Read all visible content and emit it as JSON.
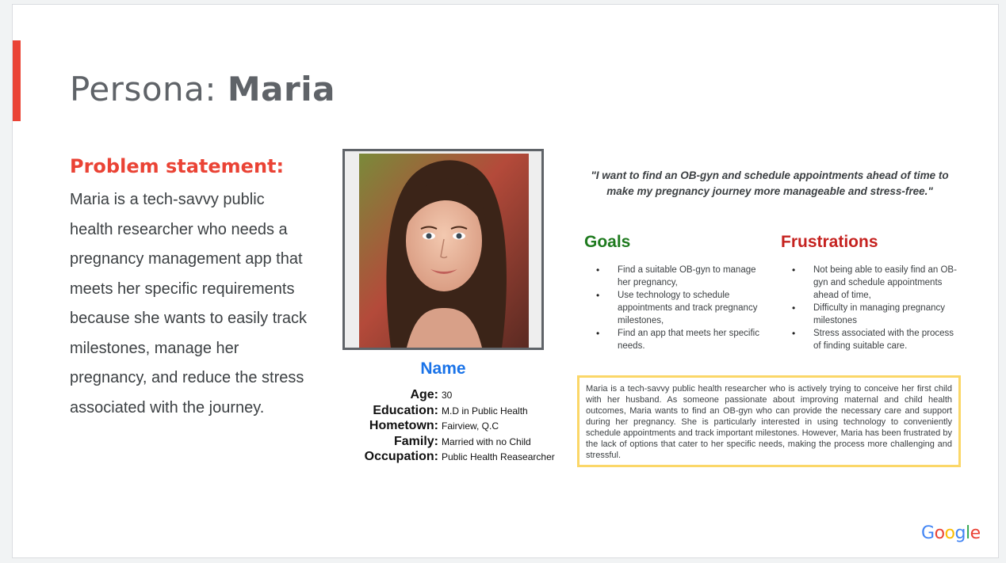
{
  "slide": {
    "title_prefix": "Persona: ",
    "title_name": "Maria"
  },
  "problem": {
    "heading": "Problem statement:",
    "body": "Maria is a tech-savvy public health researcher who needs a pregnancy management app that meets her specific requirements because she wants to easily track milestones, manage her pregnancy, and reduce the stress associated with the journey."
  },
  "persona": {
    "name_label": "Name",
    "details": [
      {
        "key": "Age:",
        "value": "30"
      },
      {
        "key": "Education:",
        "value": "M.D in Public Health"
      },
      {
        "key": "Hometown:",
        "value": "Fairview, Q.C"
      },
      {
        "key": "Family:",
        "value": "Married with no Child"
      },
      {
        "key": "Occupation:",
        "value": "Public Health Reasearcher"
      }
    ]
  },
  "quote": "\"I want to find an OB-gyn and schedule appointments ahead of time to make my pregnancy journey more manageable and stress-free.\"",
  "goals": {
    "heading": "Goals",
    "items": [
      "Find a suitable OB-gyn to manage her pregnancy,",
      "Use technology to schedule appointments and track pregnancy milestones,",
      "Find an app that meets her specific needs."
    ]
  },
  "frustrations": {
    "heading": "Frustrations",
    "items": [
      "Not being able to easily find an OB-gyn and schedule appointments ahead of time,",
      "Difficulty in managing pregnancy milestones",
      "Stress associated with the process of finding suitable care."
    ]
  },
  "bio": "Maria is a tech-savvy public health researcher who is actively trying to conceive her first child with her husband. As someone passionate about improving maternal and child health outcomes, Maria wants to find an OB-gyn who can provide the necessary care and support during her pregnancy. She is particularly interested in using technology to conveniently schedule appointments and track important milestones. However, Maria has been frustrated by the lack of options that cater to her specific needs, making the process more challenging and stressful.",
  "footer": {
    "logo_letters": [
      "G",
      "o",
      "o",
      "g",
      "l",
      "e"
    ],
    "logo_colors": [
      "#4285f4",
      "#ea4335",
      "#fbbc05",
      "#4285f4",
      "#34a853",
      "#ea4335"
    ]
  },
  "colors": {
    "accent_red": "#ea4335",
    "name_blue": "#1a73e8",
    "goals_green": "#1e7a1e",
    "frustrations_red": "#c5221f",
    "bio_border": "#fbd768"
  }
}
